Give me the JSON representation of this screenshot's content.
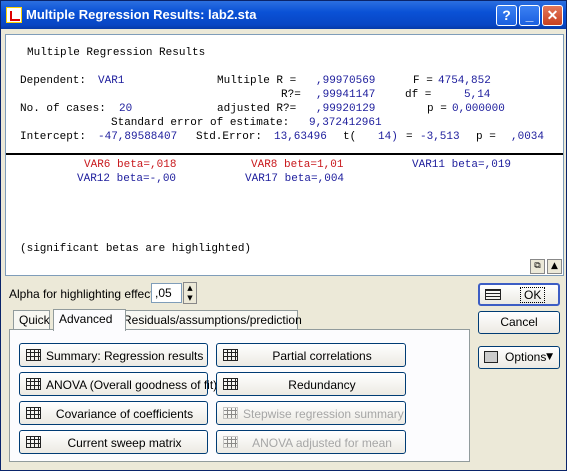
{
  "window": {
    "title": "Multiple Regression Results: lab2.sta",
    "help_glyph": "?",
    "minimize_glyph": "_",
    "close_glyph": "✕"
  },
  "output": {
    "heading": "Multiple Regression Results",
    "dependent_label": "Dependent:",
    "dependent_value": "VAR1",
    "multiple_r_label": "Multiple R =",
    "multiple_r_value": ",99970569",
    "f_label": "F =",
    "f_value": "4754,852",
    "r2_label": "R?=",
    "r2_value": ",99941147",
    "df_label": "df =",
    "df_value": "5,14",
    "cases_label": "No. of cases:",
    "cases_value": "20",
    "adj_r2_label": "adjusted R?=",
    "adj_r2_value": ",99920129",
    "p_label": "p =",
    "p_value": "0,000000",
    "std_err_est_label": "Standard error of estimate:",
    "std_err_est_value": "9,372412961",
    "intercept_label": "Intercept:",
    "intercept_value": "-47,89588407",
    "std_error_label": "Std.Error:",
    "std_error_value": "13,63496",
    "t_label": "t(",
    "t_df": "14)",
    "t_eq": "=",
    "t_value": "-3,513",
    "p2_label": "p =",
    "p2_value": ",0034",
    "betas": [
      {
        "text": "VAR6 beta=,018",
        "color": "#c8181c"
      },
      {
        "text": "VAR8 beta=1,01",
        "color": "#c8181c"
      },
      {
        "text": "VAR11 beta=,019",
        "color": "#1c1c9c"
      },
      {
        "text": "VAR12 beta=-,00",
        "color": "#1c1c9c"
      },
      {
        "text": "VAR17 beta=,004",
        "color": "#1c1c9c"
      }
    ],
    "footnote": "(significant betas are highlighted)",
    "scroll_icons": [
      "copy-icon",
      "scroll-up-icon"
    ]
  },
  "alpha": {
    "label": "Alpha for highlighting effects:",
    "value": ",05"
  },
  "tabs": [
    {
      "label": "Quick",
      "active": false
    },
    {
      "label": "Advanced",
      "active": true
    },
    {
      "label": "Residuals/assumptions/prediction",
      "active": false
    }
  ],
  "buttons": {
    "summary": "Summary:  Regression results",
    "partial": "Partial correlations",
    "anova": "ANOVA (Overall goodness of fit)",
    "redundancy": "Redundancy",
    "covariance": "Covariance of coefficients",
    "stepwise": "Stepwise regression summary",
    "sweep": "Current sweep matrix",
    "anova_adjusted": "ANOVA adjusted for mean"
  },
  "side": {
    "ok": "OK",
    "cancel": "Cancel",
    "options": "Options"
  }
}
